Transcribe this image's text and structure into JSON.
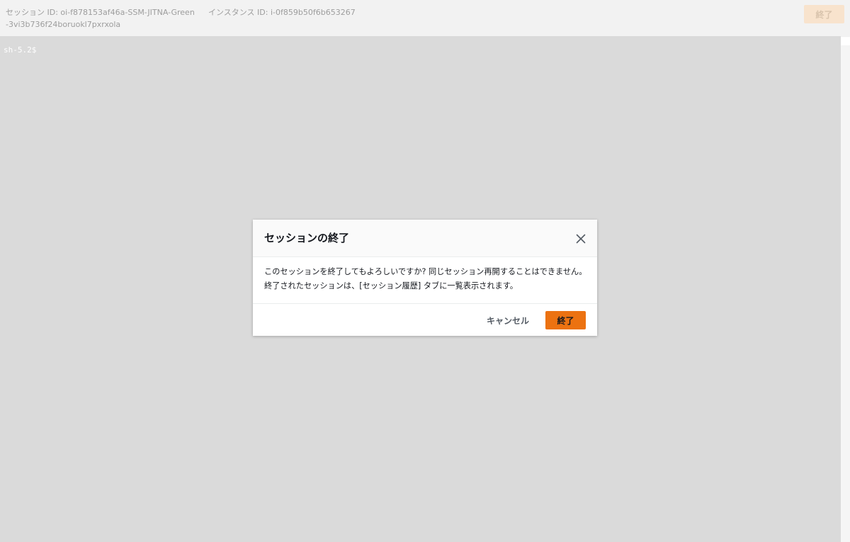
{
  "header": {
    "session_id_text": "セッション ID: oi-f878153af46a-SSM-JITNA-Green-3vi3b736f24boruokl7pxrxola",
    "instance_id_text": "インスタンス ID: i-0f859b50f6b653267",
    "terminate_label": "終了"
  },
  "terminal": {
    "prompt": "sh-5.2$"
  },
  "dialog": {
    "title": "セッションの終了",
    "close_icon": "close-icon",
    "message": "このセッションを終了してもよろしいですか? 同じセッション再開することはできません。終了されたセッションは、[セッション履歴] タブに一覧表示されます。",
    "cancel_label": "キャンセル",
    "terminate_label": "終了"
  },
  "colors": {
    "accent": "#ec7211",
    "header_bg": "#f2f2f2",
    "terminal_bg": "#dadada",
    "disabled_button_bg": "#f8e3cd"
  }
}
